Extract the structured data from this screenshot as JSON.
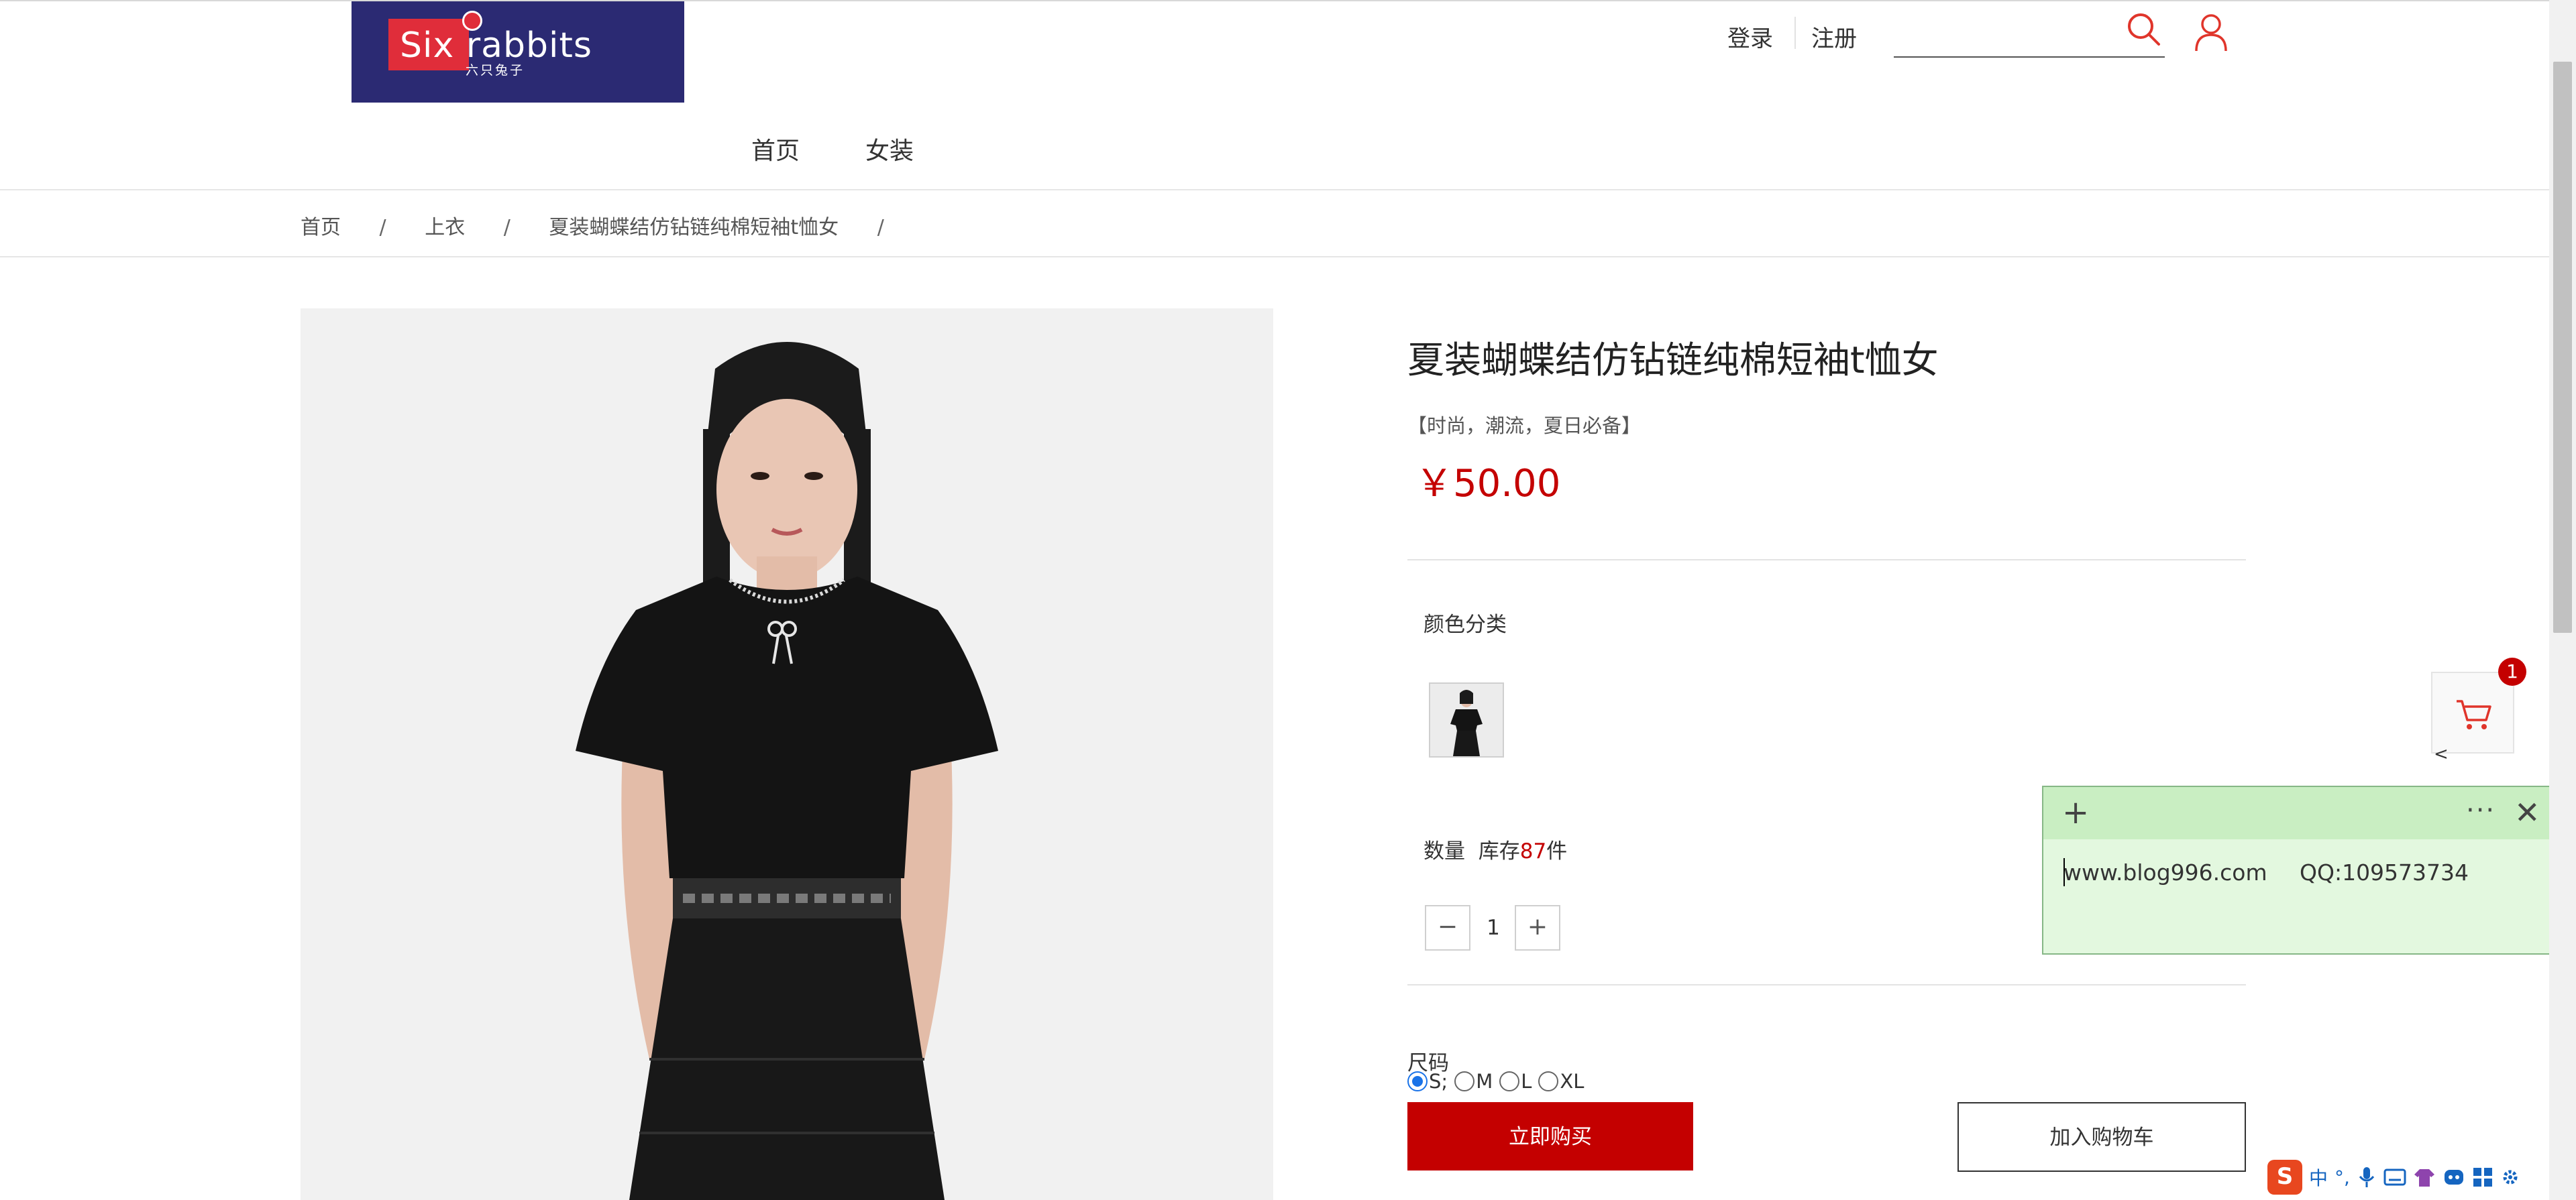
{
  "brand": {
    "logo_wordmark": "Six rabbits",
    "logo_subtitle": "六只兔子"
  },
  "header": {
    "login_label": "登录",
    "register_label": "注册",
    "search_placeholder": ""
  },
  "nav": {
    "items": [
      {
        "label": "首页"
      },
      {
        "label": "女装"
      }
    ]
  },
  "breadcrumb": {
    "items": [
      "首页",
      "上衣",
      "夏装蝴蝶结仿钻链纯棉短袖t恤女"
    ],
    "separator": "/"
  },
  "product": {
    "title": "夏装蝴蝶结仿钻链纯棉短袖t恤女",
    "tagline": "【时尚，潮流，夏日必备】",
    "price": "￥50.00",
    "color_label": "颜色分类",
    "quantity_label": "数量",
    "stock_prefix": "库存",
    "stock_count": "87",
    "stock_suffix": "件",
    "quantity_value": "1",
    "minus_label": "−",
    "plus_label": "+",
    "size_label": "尺码",
    "sizes": [
      {
        "label": "S;",
        "selected": true
      },
      {
        "label": "M",
        "selected": false
      },
      {
        "label": "L",
        "selected": false
      },
      {
        "label": "XL",
        "selected": false
      }
    ],
    "buy_now_label": "立即购买",
    "add_to_cart_label": "加入购物车"
  },
  "float_cart": {
    "badge_count": "1",
    "collapse_glyph": "<"
  },
  "sticky_note": {
    "add_glyph": "+",
    "more_glyph": "···",
    "close_glyph": "✕",
    "site": "www.blog996.com",
    "qq": "QQ:109573734"
  },
  "ime_tray": {
    "logo_glyph": "S",
    "mode_label": "中",
    "punct_label": "°,"
  },
  "colors": {
    "accent_red": "#c40000",
    "logo_bg": "#2b2a73",
    "note_bg": "#e3f8df",
    "radio_selected": "#1a73e8"
  }
}
